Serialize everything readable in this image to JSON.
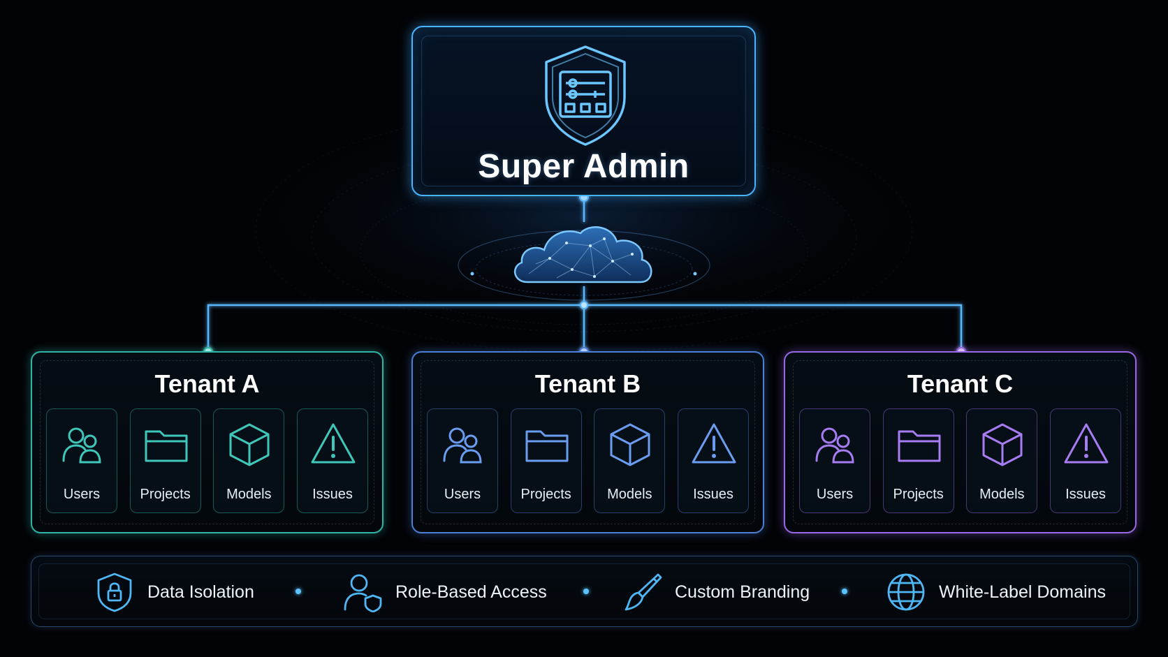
{
  "admin": {
    "title": "Super Admin",
    "icon": "shield-settings-icon"
  },
  "cloud": {
    "icon": "cloud-network-icon"
  },
  "tenants": [
    {
      "name": "Tenant A",
      "color": "#2fb5a8",
      "modules": [
        {
          "label": "Users",
          "icon": "users-icon"
        },
        {
          "label": "Projects",
          "icon": "folder-icon"
        },
        {
          "label": "Models",
          "icon": "cube-icon"
        },
        {
          "label": "Issues",
          "icon": "warning-icon"
        }
      ]
    },
    {
      "name": "Tenant B",
      "color": "#4b7fd6",
      "modules": [
        {
          "label": "Users",
          "icon": "users-icon"
        },
        {
          "label": "Projects",
          "icon": "folder-icon"
        },
        {
          "label": "Models",
          "icon": "cube-icon"
        },
        {
          "label": "Issues",
          "icon": "warning-icon"
        }
      ]
    },
    {
      "name": "Tenant C",
      "color": "#9a68e6",
      "modules": [
        {
          "label": "Users",
          "icon": "users-icon"
        },
        {
          "label": "Projects",
          "icon": "folder-icon"
        },
        {
          "label": "Models",
          "icon": "cube-icon"
        },
        {
          "label": "Issues",
          "icon": "warning-icon"
        }
      ]
    }
  ],
  "features": [
    {
      "label": "Data Isolation",
      "icon": "lock-shield-icon"
    },
    {
      "label": "Role-Based Access",
      "icon": "user-shield-icon"
    },
    {
      "label": "Custom Branding",
      "icon": "paintbrush-icon"
    },
    {
      "label": "White-Label Domains",
      "icon": "globe-icon"
    }
  ],
  "colors": {
    "accent": "#49b4ff",
    "background": "#020306"
  }
}
